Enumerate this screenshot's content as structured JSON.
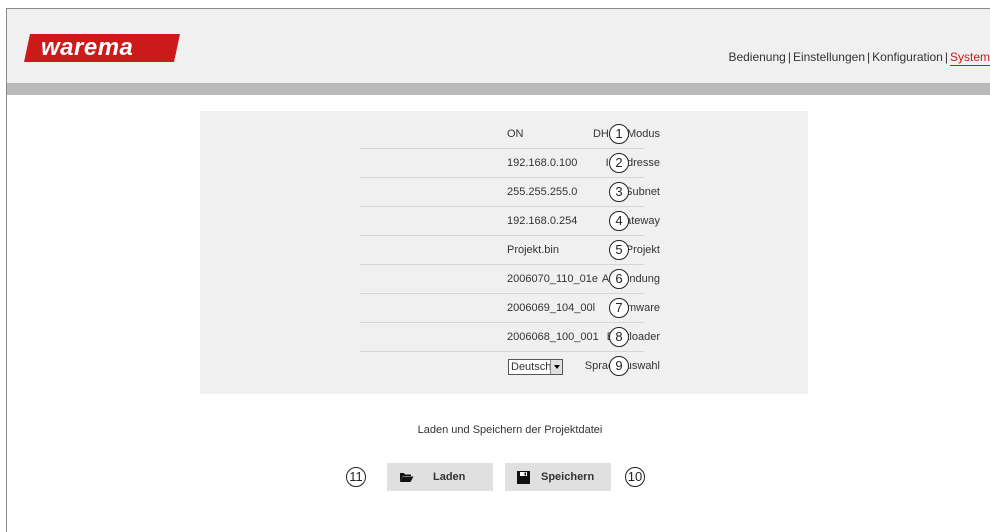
{
  "brand": {
    "logo_text": "warema",
    "color": "#cc1a1a"
  },
  "nav": {
    "items": [
      {
        "label": "Bedienung"
      },
      {
        "label": "Einstellungen"
      },
      {
        "label": "Konfiguration"
      },
      {
        "label": "System"
      }
    ],
    "separator": "|",
    "active": "System"
  },
  "settings": [
    {
      "label": "DHCP Modus",
      "value": "ON",
      "callout": "1"
    },
    {
      "label": "IP-Adresse",
      "value": "192.168.0.100",
      "callout": "2"
    },
    {
      "label": "Subnet",
      "value": "255.255.255.0",
      "callout": "3"
    },
    {
      "label": "Gateway",
      "value": "192.168.0.254",
      "callout": "4"
    },
    {
      "label": "Projekt",
      "value": "Projekt.bin",
      "callout": "5"
    },
    {
      "label": "Anwendung",
      "value": "2006070_110_01e",
      "callout": "6"
    },
    {
      "label": "Firmware",
      "value": "2006069_104_00l",
      "callout": "7"
    },
    {
      "label": "Bootloader",
      "value": "2006068_100_001",
      "callout": "8"
    },
    {
      "label": "Sprachauswahl",
      "value": "Deutsch",
      "callout": "9"
    }
  ],
  "files": {
    "title": "Laden und Speichern der Projektdatei",
    "load_label": "Laden",
    "load_icon": "folder-open-icon",
    "save_label": "Speichern",
    "save_icon": "floppy-disk-icon",
    "load_callout": "11",
    "save_callout": "10"
  }
}
